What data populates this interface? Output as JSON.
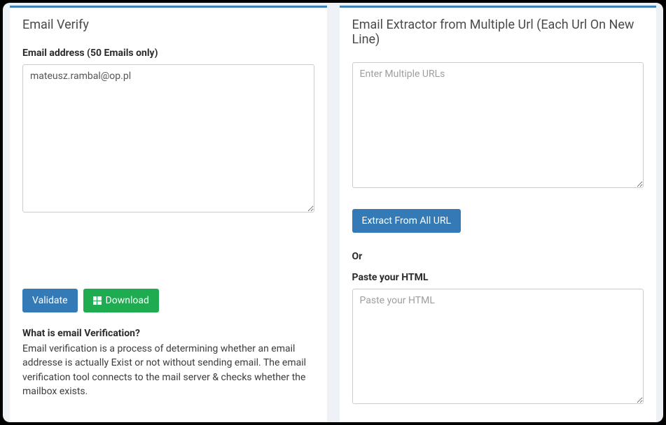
{
  "verify": {
    "title": "Email Verify",
    "email_label": "Email address (50 Emails only)",
    "email_value": "mateusz.rambal@op.pl",
    "validate_label": "Validate",
    "download_label": "Download",
    "info_title": "What is email Verification?",
    "info_text": "Email verification is a process of determining whether an email addresse is actually Exist or not without sending email. The email verification tool connects to the mail server & checks whether the mailbox exists."
  },
  "extractor": {
    "title": "Email Extractor from Multiple Url (Each Url On New Line)",
    "urls_placeholder": "Enter Multiple URLs",
    "extract_label": "Extract From All URL",
    "or_label": "Or",
    "paste_label": "Paste your HTML",
    "html_placeholder": "Paste your HTML"
  }
}
